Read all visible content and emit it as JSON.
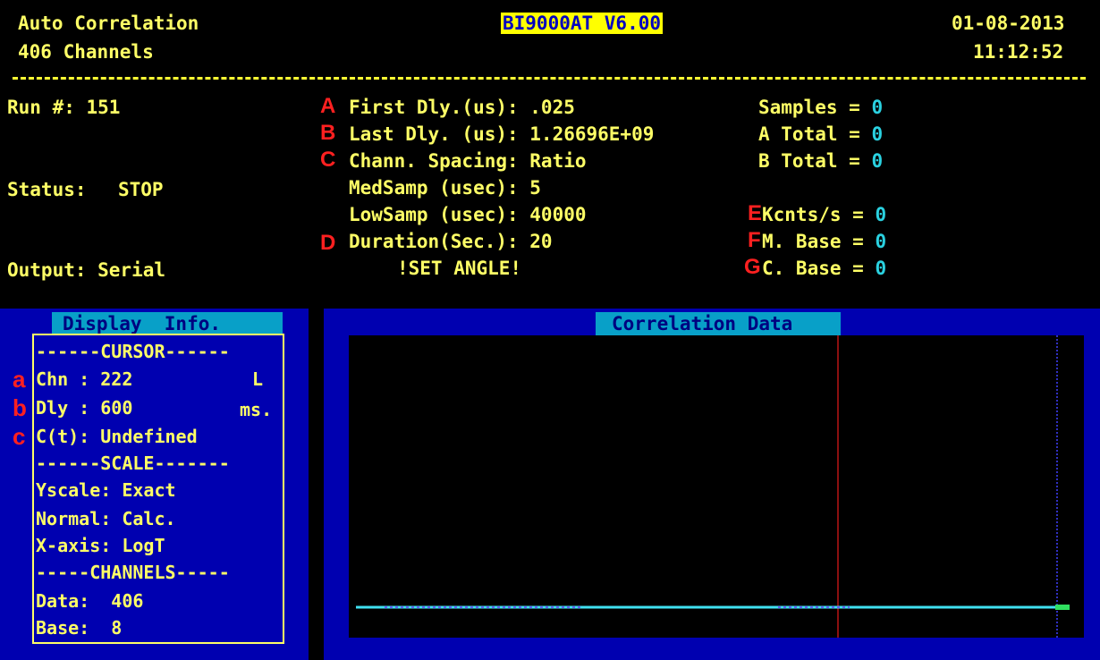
{
  "header": {
    "mode": "Auto Correlation",
    "channels": "406 Channels",
    "version": "BI9000AT V6.00",
    "date": "01-08-2013",
    "time": "11:12:52"
  },
  "status_block": {
    "run": "Run #: 151",
    "status_label": "Status:",
    "status_value": "STOP",
    "output": "Output: Serial"
  },
  "params": {
    "first_dly": "First Dly.(us): .025",
    "last_dly": "Last Dly. (us): 1.26696E+09",
    "spacing": "Chann. Spacing: Ratio",
    "medsamp": "MedSamp (usec): 5",
    "lowsamp": "LowSamp (usec): 40000",
    "duration": "Duration(Sec.): 20",
    "warning": "!SET ANGLE!"
  },
  "counts": {
    "samples_label": "Samples = ",
    "samples_value": "0",
    "atotal_label": "A Total = ",
    "atotal_value": "0",
    "btotal_label": "B Total = ",
    "btotal_value": "0",
    "kcnts_label": "Kcnts/s = ",
    "kcnts_value": "0",
    "mbase_label": "M. Base = ",
    "mbase_value": "0",
    "cbase_label": "C. Base = ",
    "cbase_value": "0"
  },
  "markers": [
    "A",
    "B",
    "C",
    "D",
    "E",
    "F",
    "G"
  ],
  "left_markers": [
    "a",
    "b",
    "c"
  ],
  "display_info": {
    "title": "Display  Info.",
    "cursor_sep": "------CURSOR------",
    "chn": "Chn : 222",
    "chn_flag": "L",
    "dly": "Dly : 600",
    "dly_unit": "ms.",
    "ct": "C(t): Undefined",
    "scale_sep": "------SCALE-------",
    "yscale": "Yscale: Exact",
    "normal": "Normal: Calc.",
    "xaxis": "X-axis: LogT",
    "channels_sep": "-----CHANNELS-----",
    "data": "Data:  406",
    "base": "Base:  8"
  },
  "correlation": {
    "title": "Correlation Data"
  },
  "colors": {
    "background": "#000000",
    "text": "#ffff66",
    "value_cyan": "#2ad1e0",
    "panel_blue": "#0000b0",
    "title_bar": "#08a0c8",
    "marker_red": "#ff2020",
    "cursor_line": "#8b1010",
    "baseline": "#40e0f0"
  }
}
